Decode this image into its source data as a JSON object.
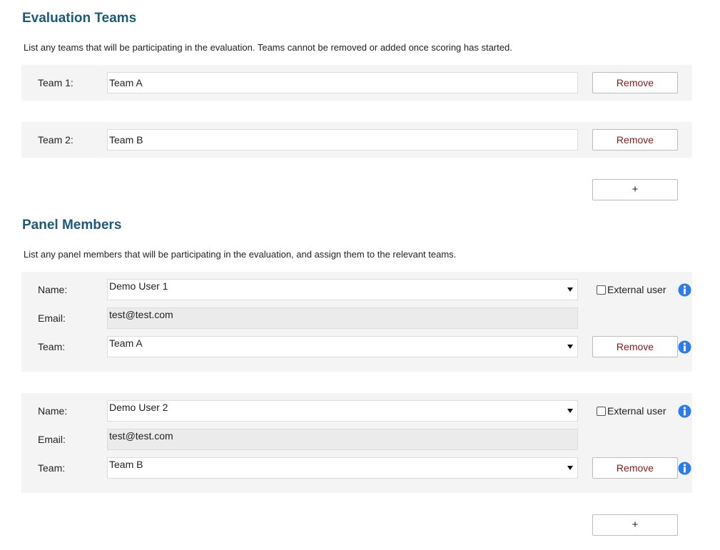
{
  "evaluation_teams": {
    "title": "Evaluation Teams",
    "description": "List any teams that will be participating in the evaluation. Teams cannot be removed or added once scoring has started.",
    "teams": [
      {
        "label": "Team 1:",
        "value": "Team A",
        "remove_label": "Remove"
      },
      {
        "label": "Team 2:",
        "value": "Team B",
        "remove_label": "Remove"
      }
    ],
    "add_label": "+"
  },
  "panel_members": {
    "title": "Panel Members",
    "description": "List any panel members that will be participating in the evaluation, and assign them to the relevant teams.",
    "members": [
      {
        "name_label": "Name:",
        "name_value": "Demo User 1",
        "external_label": "External user",
        "external_checked": false,
        "email_label": "Email:",
        "email_value": "test@test.com",
        "team_label": "Team:",
        "team_value": "Team A",
        "remove_label": "Remove"
      },
      {
        "name_label": "Name:",
        "name_value": "Demo User 2",
        "external_label": "External user",
        "external_checked": false,
        "email_label": "Email:",
        "email_value": "test@test.com",
        "team_label": "Team:",
        "team_value": "Team B",
        "remove_label": "Remove"
      }
    ],
    "add_label": "+"
  },
  "colors": {
    "heading": "#1c5a7a",
    "remove_text": "#8b1a1a",
    "info_icon": "#2b7de9",
    "panel_bg": "#f4f4f4"
  },
  "icons": {
    "info": "info-icon",
    "dropdown": "chevron-down-icon"
  }
}
